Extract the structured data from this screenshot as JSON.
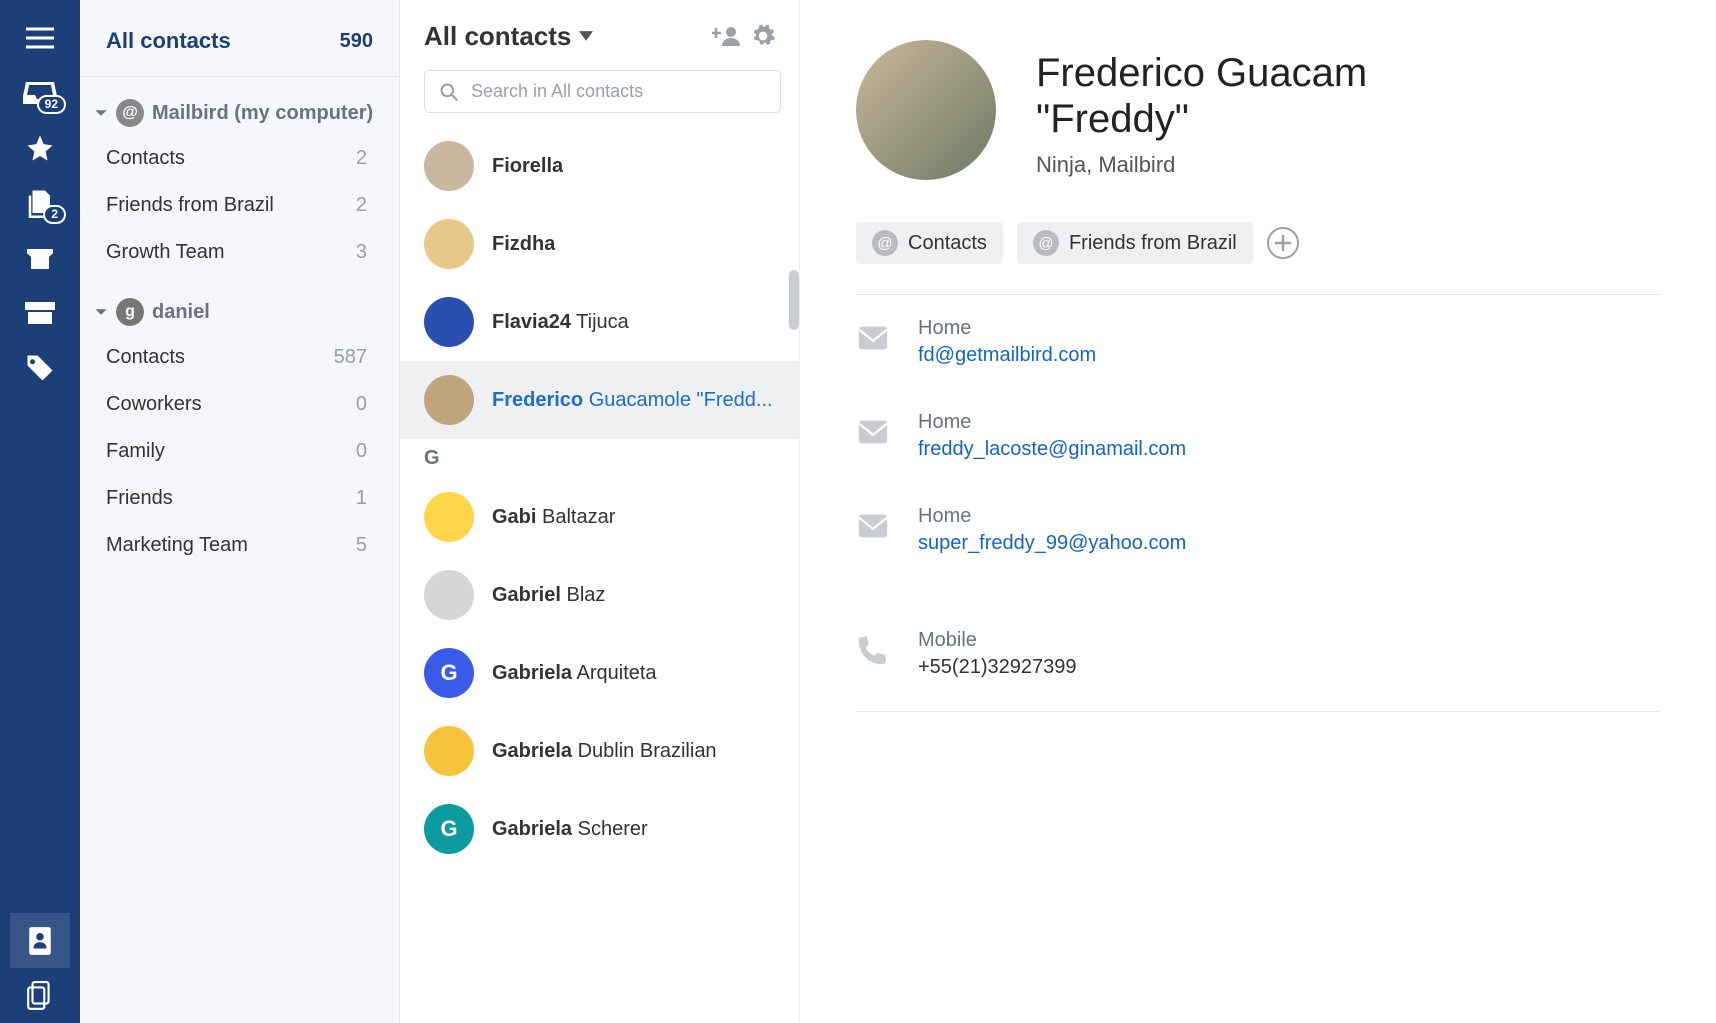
{
  "rail": {
    "inbox_badge": "92",
    "drafts_badge": "2"
  },
  "sidebar": {
    "title": "All contacts",
    "title_count": "590",
    "sections": [
      {
        "icon": "mailbird",
        "label": "Mailbird (my computer)",
        "items": [
          {
            "name": "Contacts",
            "count": "2"
          },
          {
            "name": "Friends from Brazil",
            "count": "2"
          },
          {
            "name": "Growth Team",
            "count": "3"
          }
        ]
      },
      {
        "icon": "google",
        "label": "daniel",
        "items": [
          {
            "name": "Contacts",
            "count": "587"
          },
          {
            "name": "Coworkers",
            "count": "0"
          },
          {
            "name": "Family",
            "count": "0"
          },
          {
            "name": "Friends",
            "count": "1"
          },
          {
            "name": "Marketing Team",
            "count": "5"
          }
        ]
      }
    ]
  },
  "contacts": {
    "header": "All contacts",
    "search_placeholder": "Search in All contacts",
    "section_letter": "G",
    "items": [
      {
        "first": "Fiorella",
        "rest": "",
        "avatar_bg": "#c9b89f",
        "selected": false
      },
      {
        "first": "Fizdha",
        "rest": "",
        "avatar_bg": "#e8c98a",
        "selected": false
      },
      {
        "first": "Flavia24",
        "rest": " Tijuca",
        "avatar_bg": "#2a4fae",
        "selected": false
      },
      {
        "first": "Frederico",
        "rest": " Guacamole \"Fredd...",
        "avatar_bg": "#bfa57e",
        "selected": true
      },
      {
        "first": "Gabi",
        "rest": " Baltazar",
        "avatar_bg": "#ffd54a",
        "selected": false
      },
      {
        "first": "Gabriel",
        "rest": " Blaz",
        "avatar_bg": "#d6d6d6",
        "selected": false
      },
      {
        "first": "Gabriela",
        "rest": " Arquiteta",
        "avatar_bg": "#3a5bea",
        "initial": "G",
        "selected": false
      },
      {
        "first": "Gabriela",
        "rest": " Dublin Brazilian",
        "avatar_bg": "#f7c23c",
        "selected": false
      },
      {
        "first": "Gabriela",
        "rest": " Scherer",
        "avatar_bg": "#0c9ba0",
        "initial": "G",
        "selected": false
      }
    ]
  },
  "detail": {
    "name_line1": "Frederico Guacam",
    "name_line2": "\"Freddy\"",
    "subtitle": "Ninja, Mailbird",
    "tags": [
      {
        "label": "Contacts"
      },
      {
        "label": "Friends from Brazil"
      }
    ],
    "emails": [
      {
        "label": "Home",
        "value": "fd@getmailbird.com"
      },
      {
        "label": "Home",
        "value": "freddy_lacoste@ginamail.com"
      },
      {
        "label": "Home",
        "value": "super_freddy_99@yahoo.com"
      }
    ],
    "phone": {
      "label": "Mobile",
      "value": " +55(21)32927399"
    }
  }
}
